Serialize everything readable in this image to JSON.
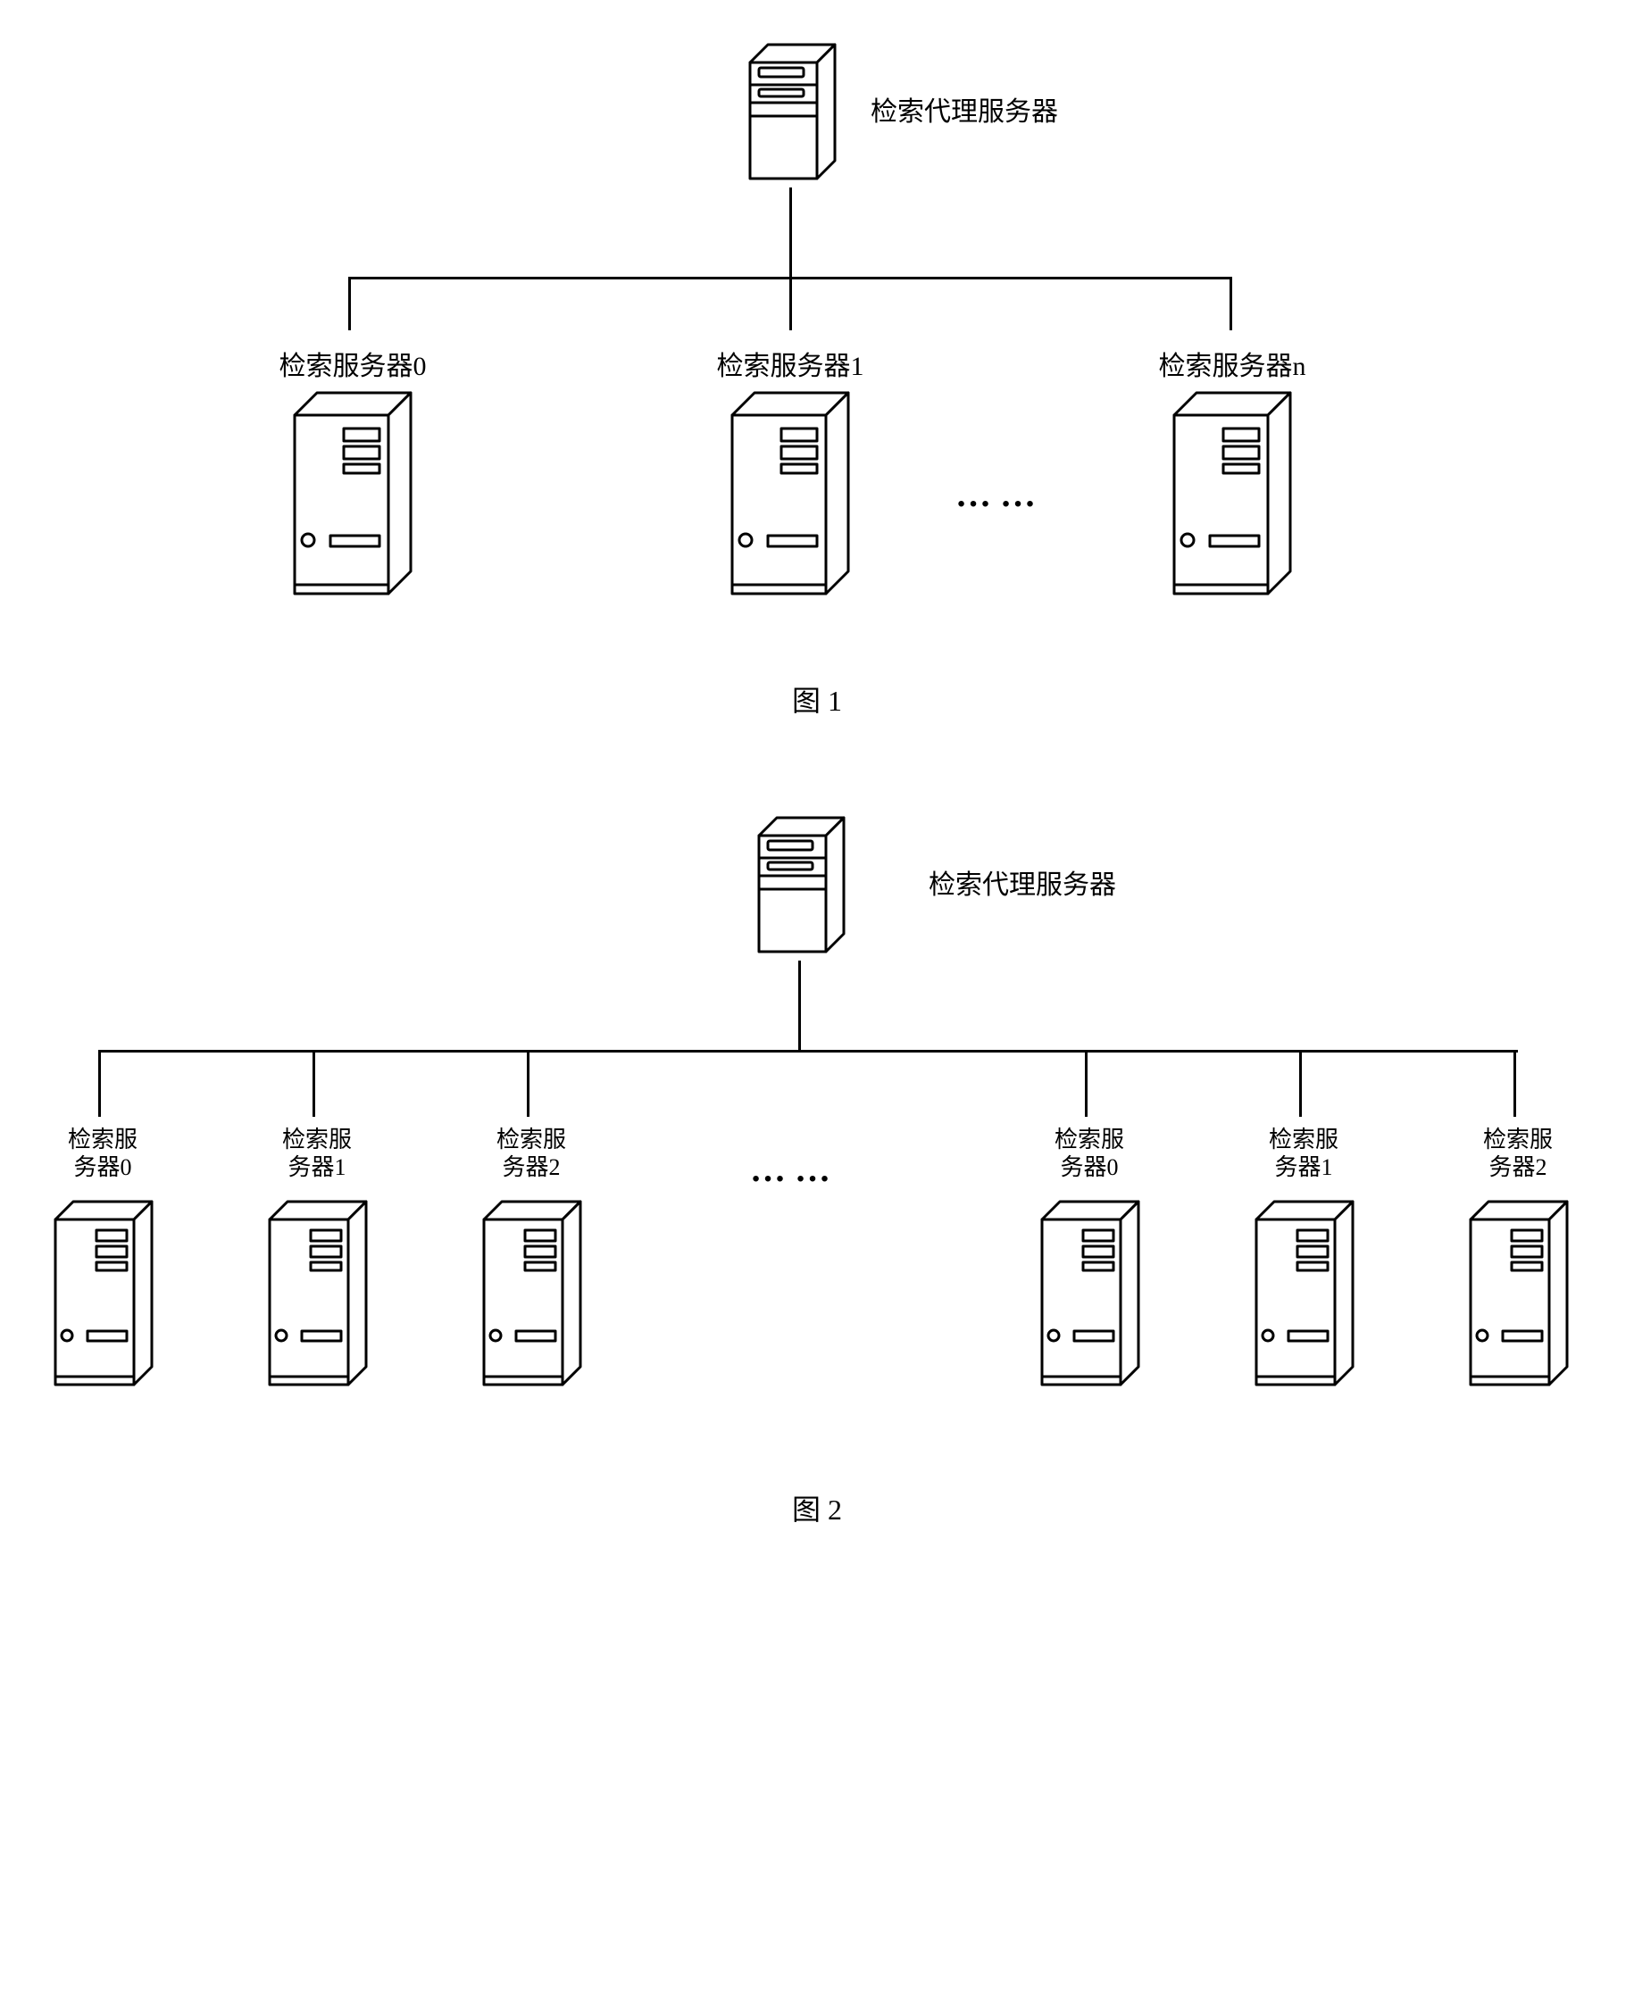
{
  "fig1": {
    "proxy_label": "检索代理服务器",
    "servers": [
      {
        "label": "检索服务器0"
      },
      {
        "label": "检索服务器1"
      },
      {
        "label": "检索服务器n"
      }
    ],
    "ellipsis": "……",
    "caption": "图 1"
  },
  "fig2": {
    "proxy_label": "检索代理服务器",
    "servers_left": [
      {
        "label": "检索服\n务器0"
      },
      {
        "label": "检索服\n务器1"
      },
      {
        "label": "检索服\n务器2"
      }
    ],
    "servers_right": [
      {
        "label": "检索服\n务器0"
      },
      {
        "label": "检索服\n务器1"
      },
      {
        "label": "检索服\n务器2"
      }
    ],
    "ellipsis": "……",
    "caption": "图 2"
  }
}
